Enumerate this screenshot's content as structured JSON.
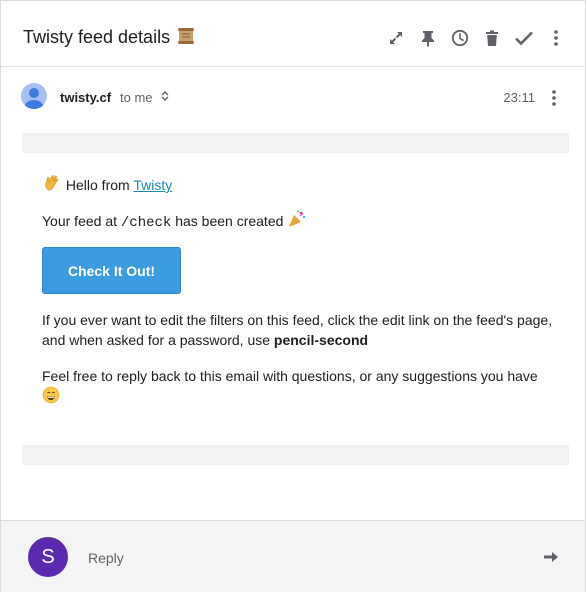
{
  "header": {
    "title": "Twisty feed details",
    "icons": [
      "scroll-icon",
      "expand-icon",
      "pin-icon",
      "snooze-clock-icon",
      "trash-icon",
      "done-check-icon",
      "more-vertical-icon"
    ]
  },
  "sender": {
    "name": "twisty.cf",
    "to_label": "to me",
    "time": "23:11"
  },
  "message": {
    "hello_text": "Hello from ",
    "hello_link": "Twisty",
    "feed_prefix": "Your feed at ",
    "feed_path": "/check",
    "feed_suffix": " has been created",
    "cta_label": "Check It Out!",
    "para1_text": "If you ever want to edit the filters on this feed, click the edit link on the feed's page, and when asked for a password, use ",
    "password": "pencil-second",
    "para2_text": "Feel free to reply back to this email with questions, or any suggestions you have"
  },
  "reply": {
    "avatar_letter": "S",
    "label": "Reply"
  },
  "colors": {
    "cta_bg": "#3d9be0",
    "avatar_purple": "#5b2aae",
    "link": "#1f8ab8"
  }
}
